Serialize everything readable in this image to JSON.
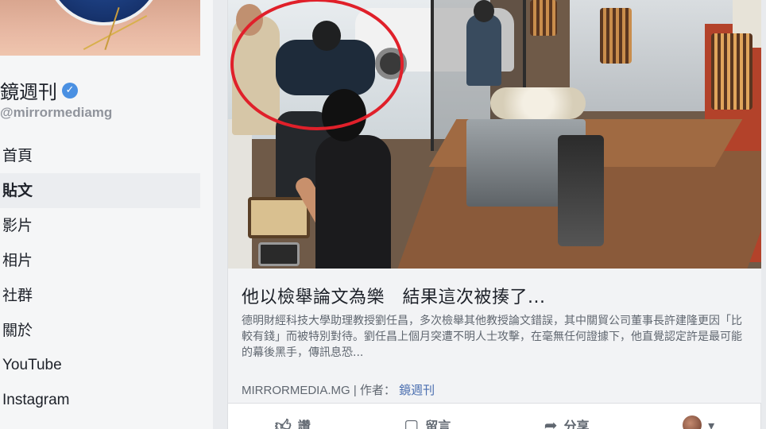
{
  "page": {
    "name": "鏡週刊",
    "handle": "@mirrormediamg"
  },
  "nav": {
    "items": [
      {
        "label": "首頁",
        "active": false
      },
      {
        "label": "貼文",
        "active": true
      },
      {
        "label": "影片",
        "active": false
      },
      {
        "label": "相片",
        "active": false
      },
      {
        "label": "社群",
        "active": false
      },
      {
        "label": "關於",
        "active": false
      },
      {
        "label": "YouTube",
        "active": false
      },
      {
        "label": "Instagram",
        "active": false
      }
    ]
  },
  "post": {
    "article_title": "他以檢舉論文為樂　結果這次被揍了...",
    "article_desc": "德明財經科技大學助理教授劉任昌，多次檢舉其他教授論文錯誤，其中關貿公司董事長許建隆更因「比較有錢」而被特別對待。劉任昌上個月突遭不明人士攻擊，在毫無任何證據下，他直覺認定許是最可能的幕後黑手，傳訊息恐...",
    "source": "MIRRORMEDIA.MG",
    "author_prefix": "| 作者：",
    "author": "鏡週刊",
    "actions": {
      "like": "讚",
      "comment": "留言",
      "share": "分享"
    }
  },
  "colors": {
    "verified_badge": "#4a90e2",
    "highlight_circle": "#e0202a",
    "link": "#4b6fb0"
  }
}
